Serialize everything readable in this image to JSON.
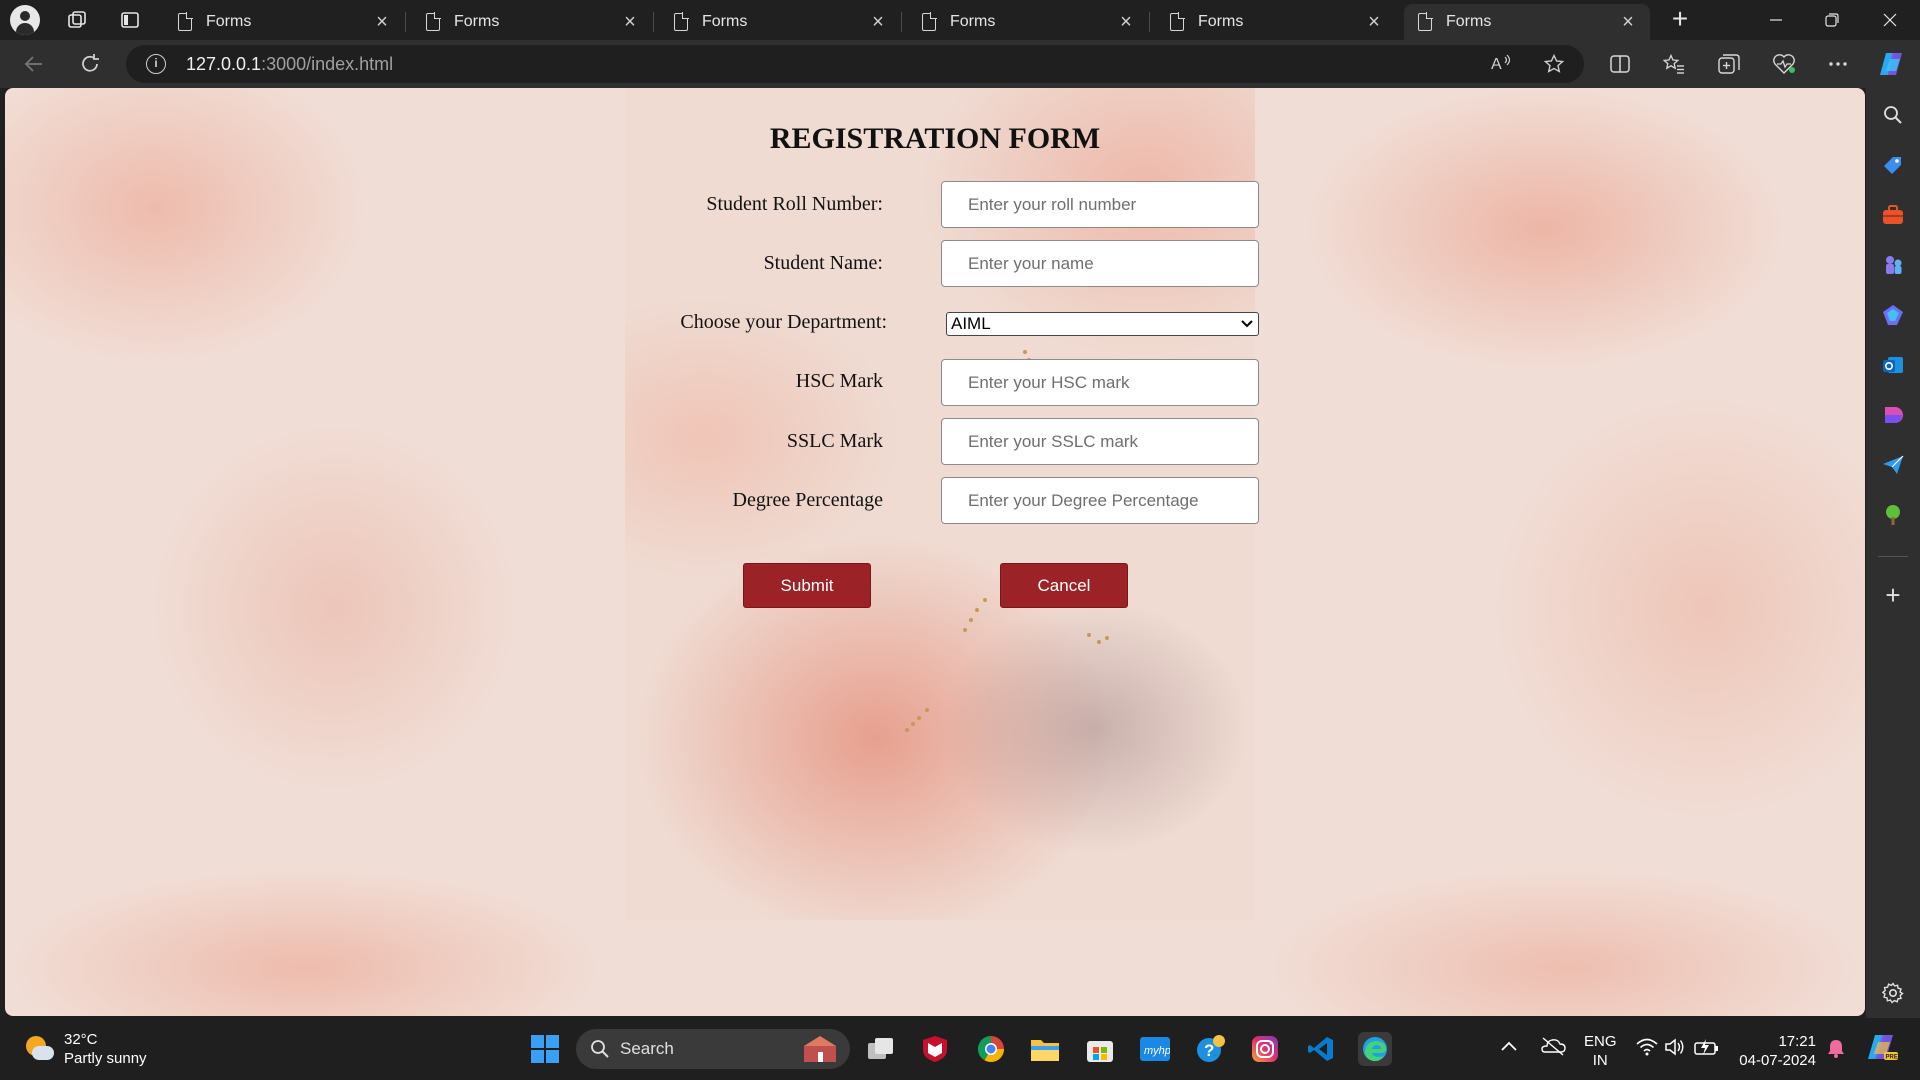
{
  "browser": {
    "tabs": [
      {
        "title": "Forms"
      },
      {
        "title": "Forms"
      },
      {
        "title": "Forms"
      },
      {
        "title": "Forms"
      },
      {
        "title": "Forms"
      },
      {
        "title": "Forms",
        "active": true
      }
    ],
    "url_host": "127.0.0.1",
    "url_rest": ":3000/index.html"
  },
  "form": {
    "title": "REGISTRATION FORM",
    "fields": [
      {
        "label": "Student Roll Number:",
        "placeholder": "Enter your roll number"
      },
      {
        "label": "Student Name:",
        "placeholder": "Enter your name"
      },
      {
        "label": "HSC Mark",
        "placeholder": "Enter your HSC mark"
      },
      {
        "label": "SSLC Mark",
        "placeholder": "Enter your SSLC mark"
      },
      {
        "label": "Degree Percentage",
        "placeholder": "Enter your Degree Percentage"
      }
    ],
    "department": {
      "label": "Choose your Department:",
      "selected": "AIML"
    },
    "submit_label": "Submit",
    "cancel_label": "Cancel"
  },
  "taskbar": {
    "weather_temp": "32°C",
    "weather_desc": "Partly sunny",
    "search_label": "Search",
    "lang_top": "ENG",
    "lang_bottom": "IN",
    "time": "17:21",
    "date": "04-07-2024"
  },
  "colors": {
    "button": "#9b2327",
    "page_background": "#f0ddd5"
  }
}
